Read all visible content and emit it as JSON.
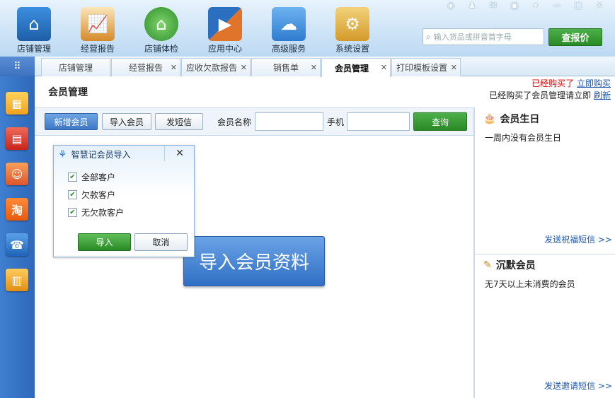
{
  "top_nav": {
    "items": [
      {
        "label": "店铺管理",
        "icon": "storefront-icon",
        "color": "#2a77c9"
      },
      {
        "label": "经营报告",
        "icon": "report-chart-icon",
        "color": "#d58a2a"
      },
      {
        "label": "店铺体检",
        "icon": "home-check-icon",
        "color": "#3aa63a"
      },
      {
        "label": "应用中心",
        "icon": "app-center-icon",
        "color": "#e0742a"
      },
      {
        "label": "高级服务",
        "icon": "cloud-icon",
        "color": "#3b8bdb"
      },
      {
        "label": "系统设置",
        "icon": "gear-icon",
        "color": "#d9a93a"
      }
    ],
    "search_placeholder": "输入货品或拼音首字母",
    "search_button": "查报价"
  },
  "tabs": [
    {
      "label": "店铺管理",
      "closable": false,
      "active": false
    },
    {
      "label": "经营报告",
      "closable": true,
      "active": false
    },
    {
      "label": "应收欠款报告",
      "closable": true,
      "active": false
    },
    {
      "label": "销售单",
      "closable": true,
      "active": false
    },
    {
      "label": "会员管理",
      "closable": true,
      "active": true
    },
    {
      "label": "打印模板设置",
      "closable": true,
      "active": false
    }
  ],
  "sidebar": {
    "icons": [
      {
        "name": "cubes-icon",
        "glyph": "▦",
        "color": "#f0a21e"
      },
      {
        "name": "calculator-icon",
        "glyph": "▤",
        "color": "#d8332a"
      },
      {
        "name": "contacts-icon",
        "glyph": "☺",
        "color": "#e86a2a"
      },
      {
        "name": "taobao-icon",
        "glyph": "淘",
        "color": "#f06a12"
      },
      {
        "name": "phone-icon",
        "glyph": "☎",
        "color": "#2c7ad0"
      },
      {
        "name": "notebook-icon",
        "glyph": "▥",
        "color": "#e89c1a"
      }
    ]
  },
  "page": {
    "title": "会员管理",
    "purchased_text": "已经购买了",
    "buy_now_link": "立即购买",
    "purchased_notice": "已经购买了会员管理请立即",
    "refresh_link": "刷新"
  },
  "toolbar": {
    "add_member": "新增会员",
    "import_member": "导入会员",
    "send_sms": "发短信",
    "member_name_label": "会员名称",
    "phone_label": "手机",
    "query_button": "查询"
  },
  "import_dialog": {
    "title": "智慧记会员导入",
    "options": [
      {
        "label": "全部客户",
        "checked": true
      },
      {
        "label": "欠款客户",
        "checked": true
      },
      {
        "label": "无欠款客户",
        "checked": true
      }
    ],
    "import_button": "导入",
    "cancel_button": "取消"
  },
  "big_import_button": "导入会员资料",
  "right_panel": {
    "birthday": {
      "title": "会员生日",
      "text": "一周内没有会员生日",
      "link": "发送祝福短信 >>"
    },
    "silent": {
      "title": "沉默会员",
      "text": "无7天以上未消费的会员",
      "link": "发送邀请短信 >>"
    }
  },
  "colors": {
    "accent_blue": "#3d78c7",
    "green_button": "#2a8a26",
    "warning_red": "#dd0000",
    "link_blue": "#1a57b0"
  }
}
